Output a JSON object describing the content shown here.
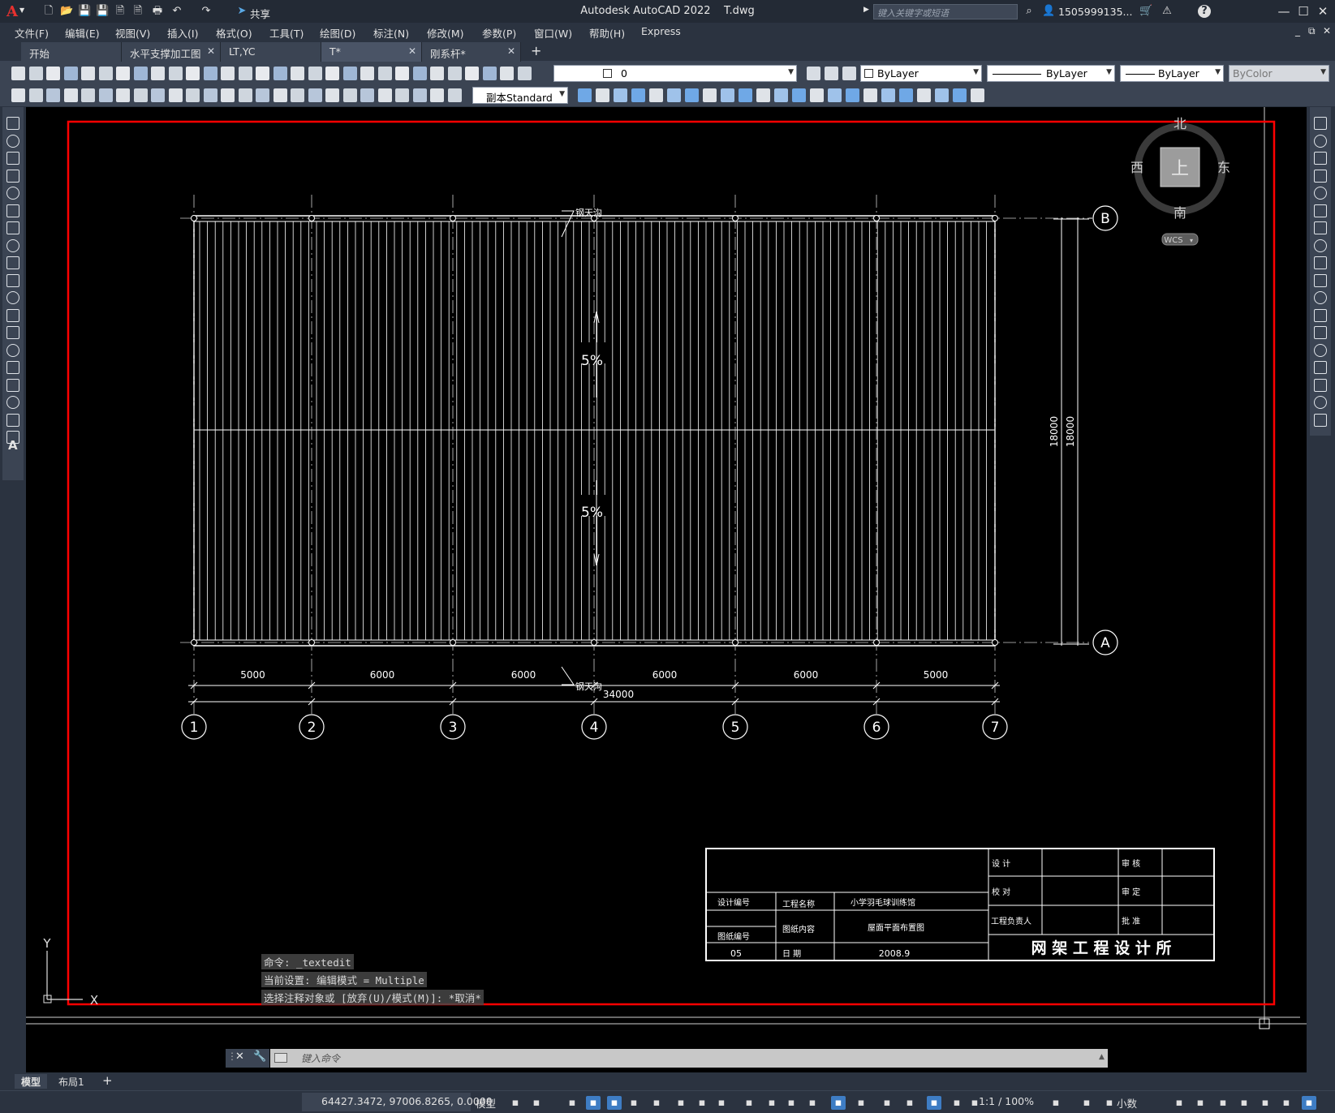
{
  "app": {
    "logo": "A",
    "title": "Autodesk AutoCAD 2022",
    "filename": "T.dwg",
    "share_label": "共享",
    "search_placeholder": "键入关键字或短语",
    "user": "1505999135...",
    "help": "?"
  },
  "menu": [
    "文件(F)",
    "编辑(E)",
    "视图(V)",
    "插入(I)",
    "格式(O)",
    "工具(T)",
    "绘图(D)",
    "标注(N)",
    "修改(M)",
    "参数(P)",
    "窗口(W)",
    "帮助(H)",
    "Express"
  ],
  "tabs": [
    {
      "label": "开始",
      "active": false,
      "closable": false
    },
    {
      "label": "水平支撑加工图",
      "active": false,
      "closable": true
    },
    {
      "label": "LT,YC",
      "active": false,
      "closable": false
    },
    {
      "label": "T*",
      "active": true,
      "closable": true
    },
    {
      "label": "刚系杆*",
      "active": false,
      "closable": true
    }
  ],
  "toolbar1": {
    "layer": "0",
    "color": "ByLayer",
    "linetype": "ByLayer",
    "lineweight": "ByLayer",
    "plotstyle": "ByColor"
  },
  "toolbar2": {
    "textstyle": "副本Standard"
  },
  "viewcube": {
    "north": "北",
    "south": "南",
    "east": "东",
    "west": "西",
    "face": "上",
    "ucs": "WCS"
  },
  "drawing": {
    "label_top": "钢天沟",
    "label_bottom": "钢天沟",
    "slope_upper": "5%",
    "slope_lower": "5%",
    "dims": [
      "5000",
      "6000",
      "6000",
      "6000",
      "6000",
      "5000"
    ],
    "total_dim": "34000",
    "vertical_dim": "18000",
    "vertical_dim2": "18000",
    "grid_cols": [
      "1",
      "2",
      "3",
      "4",
      "5",
      "6",
      "7"
    ],
    "grid_rows": [
      "B",
      "A"
    ]
  },
  "title_block": {
    "design": "设    计",
    "check": "校    对",
    "manager": "工程负责人",
    "review": "审    核",
    "approve": "审    定",
    "ratify": "批    准",
    "design_no_label": "设计编号",
    "project_name_label": "工程名称",
    "project_name": "小学羽毛球训练馆",
    "drawing_content_label": "图纸内容",
    "drawing_content": "屋面平面布置图",
    "drawing_no_label": "图纸编号",
    "drawing_no": "05",
    "date_label": "日    期",
    "date": "2008.9",
    "company": "网 架 工 程 设 计 所"
  },
  "ucs_icon": {
    "x": "X",
    "y": "Y"
  },
  "command": {
    "history": [
      "命令: _textedit",
      "当前设置: 编辑模式 = Multiple",
      "选择注释对象或 [放弃(U)/模式(M)]: *取消*"
    ],
    "placeholder": "键入命令"
  },
  "layouts": [
    "模型",
    "布局1"
  ],
  "status": {
    "coords": "64427.3472, 97006.8265, 0.0000",
    "model": "模型",
    "scale": "1:1 / 100%",
    "units": "小数"
  },
  "colors": {
    "border": "#ff0000",
    "canvas": "#000000",
    "lines": "#ffffff",
    "accent": "#3e7dc4"
  }
}
